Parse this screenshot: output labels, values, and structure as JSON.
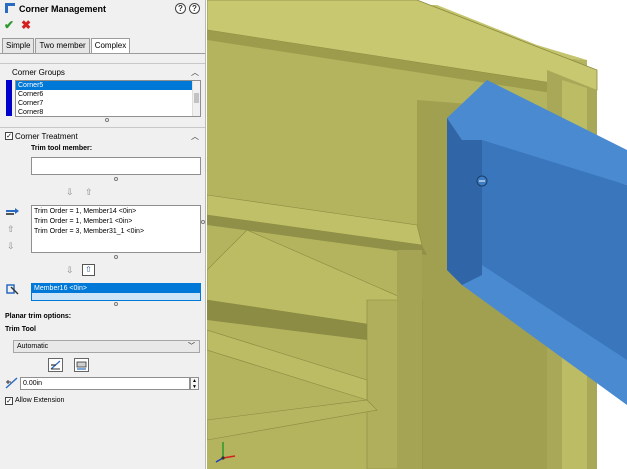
{
  "panel": {
    "title": "Corner Management",
    "confirm_icon": "check-icon",
    "cancel_icon": "close-icon",
    "tabs": [
      {
        "label": "Simple"
      },
      {
        "label": "Two member"
      },
      {
        "label": "Complex"
      }
    ],
    "corner_groups": {
      "header": "Corner Groups",
      "items": [
        "Corner5",
        "Corner6",
        "Corner7",
        "Corner8"
      ],
      "selected": "Corner5"
    },
    "corner_treatment": {
      "header": "Corner Treatment",
      "trim_tool_label": "Trim tool member:",
      "trim_orders": [
        "Trim Order = 1, Member14   <0in>",
        "Trim Order = 1, Member1   <0in>",
        "Trim Order = 3, Member31_1   <0in>"
      ],
      "member_selected": "Member16   <0in>"
    },
    "planar_label": "Planar trim options:",
    "trim_tool_header": "Trim Tool",
    "trim_tool_value": "Automatic",
    "gap_value": "0.00in",
    "allow_extension_label": "Allow Extension",
    "allow_extension_checked": true
  },
  "colors": {
    "frame_yellow": "#b4b45e",
    "beam_blue": "#3d7ec5",
    "accent": "#0078d7",
    "color_strip": "#0000cc"
  }
}
